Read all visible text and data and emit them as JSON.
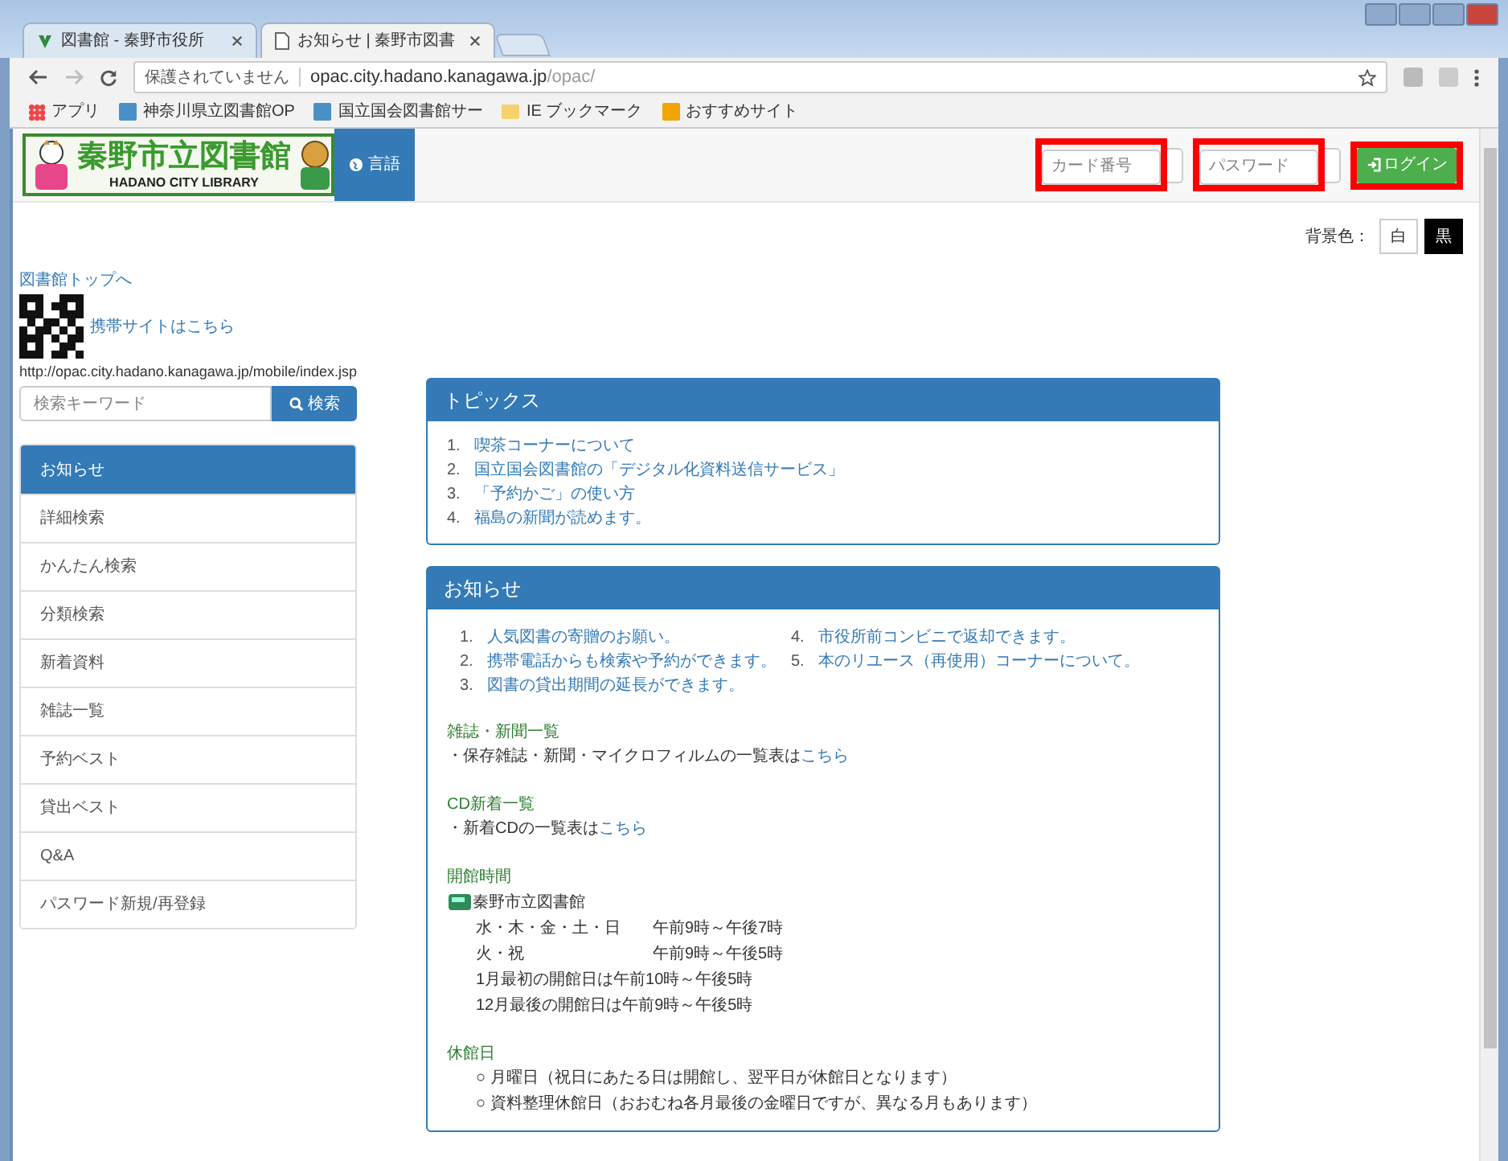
{
  "browser": {
    "tabs": [
      {
        "title": "図書館 - 秦野市役所",
        "selected": false
      },
      {
        "title": "お知らせ | 秦野市図書",
        "selected": true
      }
    ],
    "address": {
      "security": "保護されていません",
      "host": "opac.city.hadano.kanagawa.jp",
      "path": "/opac/"
    },
    "bookmarks": [
      {
        "label": "アプリ",
        "kind": "apps"
      },
      {
        "label": "神奈川県立図書館OP",
        "kind": "site"
      },
      {
        "label": "国立国会図書館サー",
        "kind": "site"
      },
      {
        "label": "IE ブックマーク",
        "kind": "folder"
      },
      {
        "label": "おすすめサイト",
        "kind": "bing"
      }
    ]
  },
  "header": {
    "logo_title": "秦野市立図書館",
    "logo_subtitle": "HADANO CITY LIBRARY",
    "language_button": "言語",
    "card_field": {
      "placeholder": "カード番号",
      "highlighted": true
    },
    "password_field": {
      "placeholder": "パスワード",
      "highlighted": true
    },
    "login_button": {
      "label": "ログイン",
      "highlighted": true
    },
    "background_label": "背景色：",
    "background_options": [
      {
        "label": "白",
        "kind": "white"
      },
      {
        "label": "黒",
        "kind": "black"
      }
    ]
  },
  "sidebar": {
    "top_link": "図書館トップへ",
    "mobile_link": "携帯サイトはこちら",
    "mobile_url": "http://opac.city.hadano.kanagawa.jp/mobile/index.jsp",
    "search": {
      "placeholder": "検索キーワード",
      "button": "検索"
    },
    "items": [
      {
        "label": "お知らせ",
        "selected": true
      },
      {
        "label": "詳細検索",
        "selected": false
      },
      {
        "label": "かんたん検索",
        "selected": false
      },
      {
        "label": "分類検索",
        "selected": false
      },
      {
        "label": "新着資料",
        "selected": false
      },
      {
        "label": "雑誌一覧",
        "selected": false
      },
      {
        "label": "予約ベスト",
        "selected": false
      },
      {
        "label": "貸出ベスト",
        "selected": false
      },
      {
        "label": "Q&A",
        "selected": false
      },
      {
        "label": "パスワード新規/再登録",
        "selected": false
      }
    ]
  },
  "topics": {
    "title": "トピックス",
    "items": [
      {
        "number": "1.",
        "text": "喫茶コーナーについて"
      },
      {
        "number": "2.",
        "text": "国立国会図書館の「デジタル化資料送信サービス」"
      },
      {
        "number": "3.",
        "text": "「予約かご」の使い方"
      },
      {
        "number": "4.",
        "text": "福島の新聞が読めます。"
      }
    ]
  },
  "notices": {
    "title": "お知らせ",
    "items": [
      {
        "number": "1.",
        "text": "人気図書の寄贈のお願い。"
      },
      {
        "number": "2.",
        "text": "携帯電話からも検索や予約ができます。"
      },
      {
        "number": "3.",
        "text": "図書の貸出期間の延長ができます。"
      },
      {
        "number": "4.",
        "text": "市役所前コンビニで返却できます。"
      },
      {
        "number": "5.",
        "text": "本のリユース（再使用）コーナーについて。"
      }
    ],
    "magazines": {
      "heading": "雑誌・新聞一覧",
      "text": "・保存雑誌・新聞・マイクロフィルムの一覧表は",
      "link": "こちら"
    },
    "cd": {
      "heading": "CD新着一覧",
      "text": "・新着CDの一覧表は",
      "link": "こちら"
    },
    "hours": {
      "heading": "開館時間",
      "library": "秦野市立図書館",
      "rows": [
        {
          "days": "水・木・金・土・日",
          "time": "午前9時～午後7時"
        },
        {
          "days": "火・祝",
          "time": "午前9時～午後5時"
        }
      ],
      "notes": [
        "1月最初の開館日は午前10時～午後5時",
        "12月最後の開館日は午前9時～午後5時"
      ]
    },
    "closed": {
      "heading": "休館日",
      "items": [
        "○ 月曜日（祝日にあたる日は開館し、翌平日が休館日となります）",
        "○ 資料整理休館日（おおむね各月最後の金曜日ですが、異なる月もあります）"
      ]
    }
  }
}
